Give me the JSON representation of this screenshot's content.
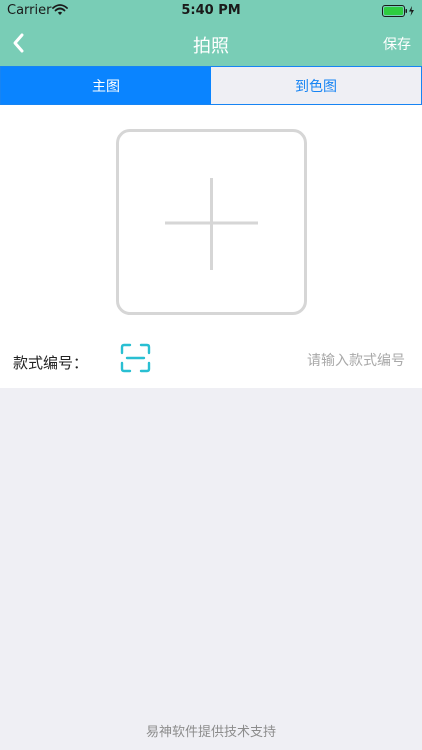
{
  "status_bar": {
    "carrier": "Carrier",
    "time": "5:40 PM",
    "wifi_icon": "wifi-icon",
    "battery_icon": "battery-charging-icon"
  },
  "nav_bar": {
    "title": "拍照",
    "back_icon": "chevron-left-icon",
    "save_label": "保存",
    "background_color": "#79cdb6"
  },
  "tabs": [
    {
      "label": "主图",
      "active": true
    },
    {
      "label": "到色图",
      "active": false
    }
  ],
  "tab_colors": {
    "active_bg": "#0a84ff",
    "accent": "#1784f3"
  },
  "photo": {
    "add_icon": "plus-icon"
  },
  "style_number": {
    "label": "款式编号：",
    "scan_icon": "scan-icon",
    "placeholder": "请输入款式编号",
    "value": ""
  },
  "footer": {
    "text": "易神软件提供技术支持"
  }
}
